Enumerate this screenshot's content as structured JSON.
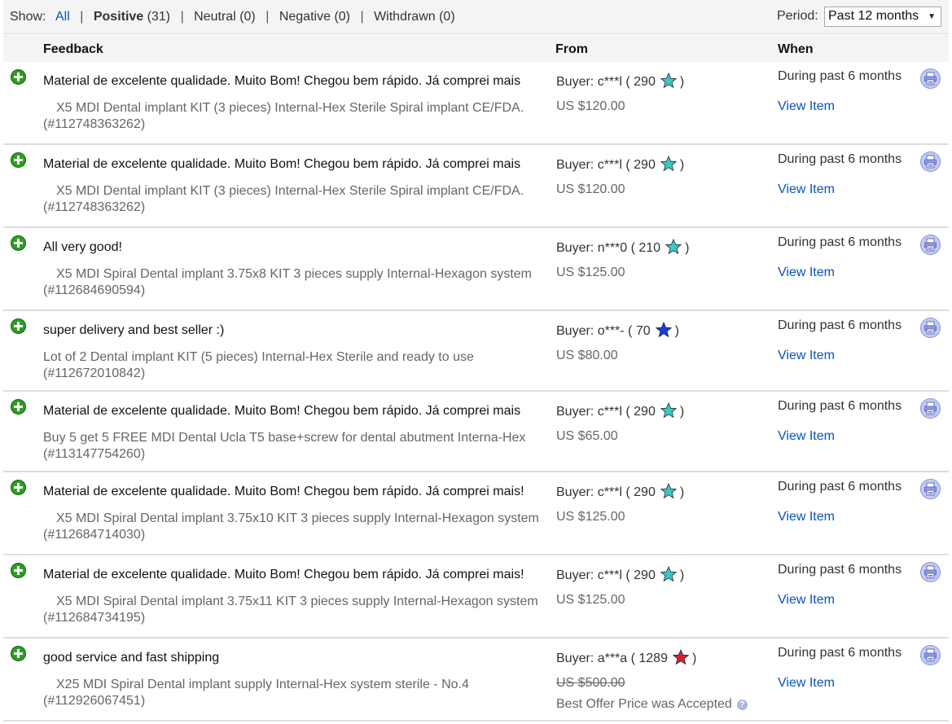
{
  "filter": {
    "show_label": "Show:",
    "options": [
      {
        "label": "All",
        "count": "",
        "state": "link"
      },
      {
        "label": "Positive",
        "count": "(31)",
        "state": "current"
      },
      {
        "label": "Neutral",
        "count": "(0)",
        "state": "plain"
      },
      {
        "label": "Negative",
        "count": "(0)",
        "state": "plain"
      },
      {
        "label": "Withdrawn",
        "count": "(0)",
        "state": "plain"
      }
    ],
    "separator": "|",
    "period_label": "Period:",
    "period_value": "Past 12 months"
  },
  "columns": {
    "feedback": "Feedback",
    "from": "From",
    "when": "When"
  },
  "rows": [
    {
      "comment": "Material de excelente qualidade. Muito Bom! Chegou bem rápido. Já comprei mais",
      "item_line1": "　X5 MDI Dental implant KIT (3 pieces) Internal-Hex Sterile Spiral implant CE/FDA.",
      "item_line2": "(#112748363262)",
      "buyer_label": "Buyer: c***l ( 290",
      "buyer_close": ")",
      "star_color": "#3ec7c2",
      "price": "US $120.00",
      "price_struck": false,
      "best_offer": "",
      "when": "During past 6 months",
      "view": "View Item"
    },
    {
      "comment": "Material de excelente qualidade. Muito Bom! Chegou bem rápido. Já comprei mais",
      "item_line1": "　X5 MDI Dental implant KIT (3 pieces) Internal-Hex Sterile Spiral implant CE/FDA.",
      "item_line2": "(#112748363262)",
      "buyer_label": "Buyer: c***l ( 290",
      "buyer_close": ")",
      "star_color": "#3ec7c2",
      "price": "US $120.00",
      "price_struck": false,
      "best_offer": "",
      "when": "During past 6 months",
      "view": "View Item"
    },
    {
      "comment": "All very good!",
      "item_line1": "　X5 MDI Spiral Dental implant 3.75x8 KIT 3 pieces supply Internal-Hexagon system",
      "item_line2": "(#112684690594)",
      "buyer_label": "Buyer: n***0 ( 210",
      "buyer_close": ")",
      "star_color": "#3ec7c2",
      "price": "US $125.00",
      "price_struck": false,
      "best_offer": "",
      "when": "During past 6 months",
      "view": "View Item"
    },
    {
      "comment": "super delivery and best seller :)",
      "item_line1": "Lot of 2 Dental implant KIT (5 pieces) Internal-Hex Sterile and ready to use",
      "item_line2": "(#112672010842)",
      "buyer_label": "Buyer: o***- ( 70",
      "buyer_close": ")",
      "star_color": "#1a3fd6",
      "price": "US $80.00",
      "price_struck": false,
      "best_offer": "",
      "when": "During past 6 months",
      "view": "View Item"
    },
    {
      "comment": "Material de excelente qualidade. Muito Bom! Chegou bem rápido. Já comprei mais",
      "item_line1": "Buy 5 get 5 FREE MDI Dental Ucla T5 base+screw for dental abutment Interna-Hex",
      "item_line2": "(#113147754260)",
      "buyer_label": "Buyer: c***l ( 290",
      "buyer_close": ")",
      "star_color": "#3ec7c2",
      "price": "US $65.00",
      "price_struck": false,
      "best_offer": "",
      "when": "During past 6 months",
      "view": "View Item"
    },
    {
      "comment": "Material de excelente qualidade. Muito Bom! Chegou bem rápido. Já comprei mais!",
      "item_line1": "　X5 MDI Spiral Dental implant 3.75x10 KIT 3 pieces supply Internal-Hexagon system",
      "item_line2": "(#112684714030)",
      "buyer_label": "Buyer: c***l ( 290",
      "buyer_close": ")",
      "star_color": "#3ec7c2",
      "price": "US $125.00",
      "price_struck": false,
      "best_offer": "",
      "when": "During past 6 months",
      "view": "View Item"
    },
    {
      "comment": "Material de excelente qualidade. Muito Bom! Chegou bem rápido. Já comprei mais!",
      "item_line1": "　X5 MDI Spiral Dental implant 3.75x11 KIT 3 pieces supply Internal-Hexagon system",
      "item_line2": "(#112684734195)",
      "buyer_label": "Buyer: c***l ( 290",
      "buyer_close": ")",
      "star_color": "#3ec7c2",
      "price": "US $125.00",
      "price_struck": false,
      "best_offer": "",
      "when": "During past 6 months",
      "view": "View Item"
    },
    {
      "comment": "good service and fast shipping",
      "item_line1": "　X25 MDI Spiral Dental implant supply Internal-Hex system sterile - No.4",
      "item_line2": "(#112926067451)",
      "buyer_label": "Buyer: a***a ( 1289",
      "buyer_close": ")",
      "star_color": "#d8202a",
      "price": "US $500.00",
      "price_struck": true,
      "best_offer": "Best Offer Price was Accepted",
      "when": "During past 6 months",
      "view": "View Item"
    }
  ]
}
